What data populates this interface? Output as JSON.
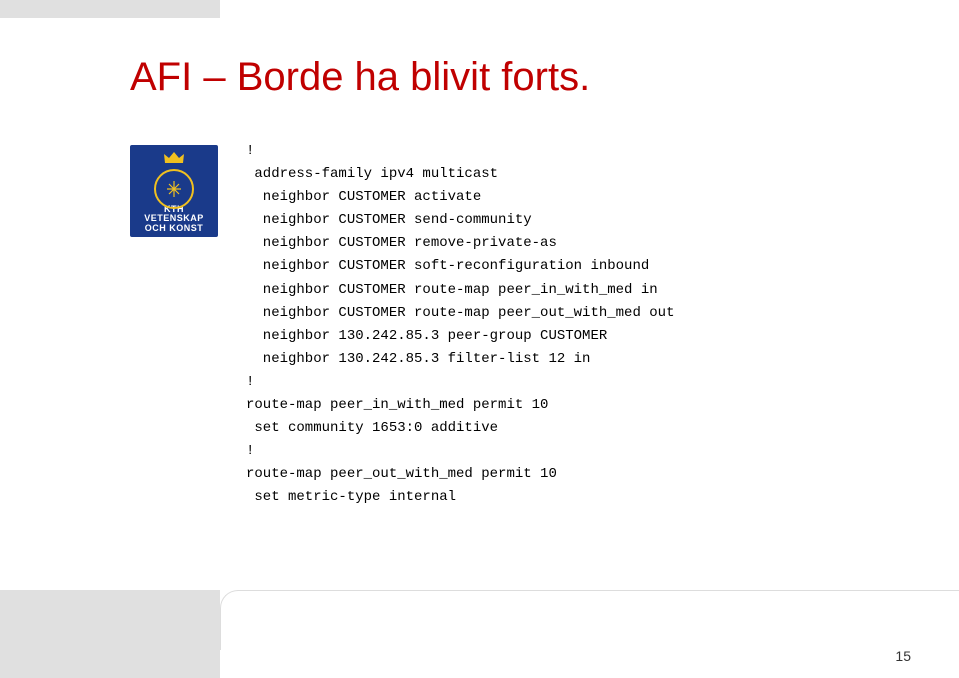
{
  "title": "AFI – Borde ha blivit forts.",
  "logo": {
    "line1": "KTH",
    "line2": "VETENSKAP",
    "line3": "OCH KONST"
  },
  "code_lines": [
    "!",
    " address-family ipv4 multicast",
    "  neighbor CUSTOMER activate",
    "  neighbor CUSTOMER send-community",
    "  neighbor CUSTOMER remove-private-as",
    "  neighbor CUSTOMER soft-reconfiguration inbound",
    "  neighbor CUSTOMER route-map peer_in_with_med in",
    "  neighbor CUSTOMER route-map peer_out_with_med out",
    "  neighbor 130.242.85.3 peer-group CUSTOMER",
    "  neighbor 130.242.85.3 filter-list 12 in",
    "!",
    "route-map peer_in_with_med permit 10",
    " set community 1653:0 additive",
    "!",
    "route-map peer_out_with_med permit 10",
    " set metric-type internal"
  ],
  "page_number": "15"
}
